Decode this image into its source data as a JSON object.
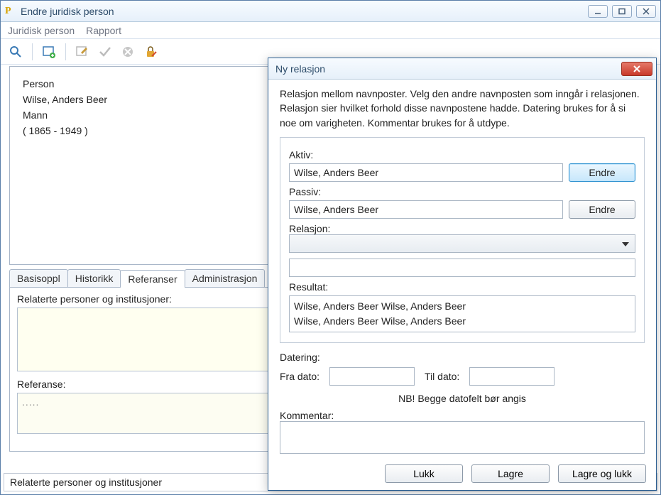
{
  "window": {
    "title": "Endre juridisk person"
  },
  "menu": {
    "item1": "Juridisk person",
    "item2": "Rapport"
  },
  "person": {
    "type": "Person",
    "name": "Wilse, Anders Beer",
    "gender": "Mann",
    "dates": "( 1865 - 1949 )"
  },
  "tabs": {
    "t1": "Basisoppl",
    "t2": "Historikk",
    "t3": "Referanser",
    "t4": "Administrasjon"
  },
  "panel": {
    "related_label": "Relaterte personer og institusjoner:",
    "reference_label": "Referanse:",
    "reference_value": "....."
  },
  "statusbar": "Relaterte personer og institusjoner",
  "dialog": {
    "title": "Ny relasjon",
    "intro": "Relasjon mellom navnposter. Velg den andre navnposten som inngår i relasjonen. Relasjon sier hvilket forhold disse navnpostene hadde. Datering brukes for å si noe om varigheten. Kommentar brukes for å utdype.",
    "aktiv_label": "Aktiv:",
    "aktiv_value": "Wilse, Anders Beer",
    "passiv_label": "Passiv:",
    "passiv_value": "Wilse, Anders Beer",
    "endre": "Endre",
    "relasjon_label": "Relasjon:",
    "resultat_label": "Resultat:",
    "resultat_line1": "Wilse, Anders Beer  Wilse, Anders Beer",
    "resultat_line2": "Wilse, Anders Beer  Wilse, Anders Beer",
    "datering_label": "Datering:",
    "fra_label": "Fra dato:",
    "til_label": "Til dato:",
    "date_note": "NB! Begge datofelt bør angis",
    "kommentar_label": "Kommentar:",
    "btn_close": "Lukk",
    "btn_save": "Lagre",
    "btn_save_close": "Lagre og lukk"
  }
}
